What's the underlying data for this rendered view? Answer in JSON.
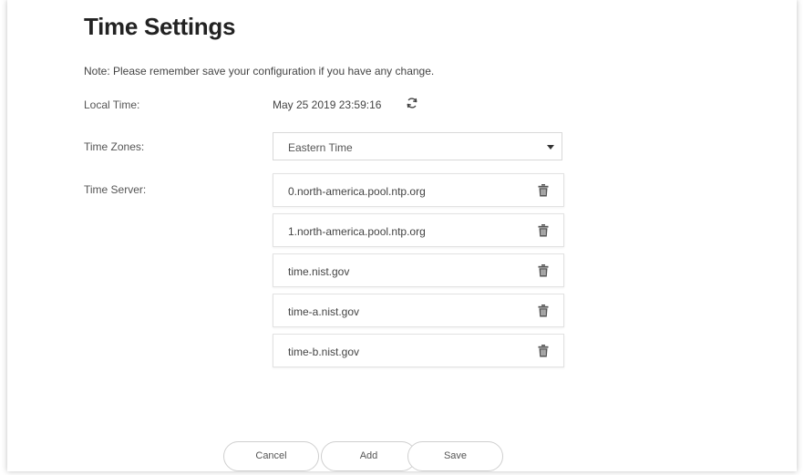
{
  "page": {
    "title": "Time Settings",
    "note": "Note: Please remember save your configuration if you have any change."
  },
  "local_time": {
    "label": "Local Time:",
    "value": "May 25 2019 23:59:16",
    "refresh_icon": "refresh-icon"
  },
  "time_zones": {
    "label": "Time Zones:",
    "selected": "Eastern Time"
  },
  "time_server": {
    "label": "Time Server:",
    "servers": [
      "0.north-america.pool.ntp.org",
      "1.north-america.pool.ntp.org",
      "time.nist.gov",
      "time-a.nist.gov",
      "time-b.nist.gov"
    ],
    "delete_icon": "trash-icon"
  },
  "buttons": {
    "cancel": "Cancel",
    "add": "Add",
    "save": "Save"
  }
}
